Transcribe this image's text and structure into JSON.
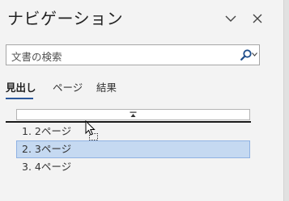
{
  "pane": {
    "title": "ナビゲーション"
  },
  "search": {
    "placeholder": "文書の検索"
  },
  "tabs": [
    {
      "label": "見出し",
      "active": true
    },
    {
      "label": "ページ",
      "active": false
    },
    {
      "label": "結果",
      "active": false
    }
  ],
  "headings": [
    {
      "label": "1. 2ページ",
      "selected": false
    },
    {
      "label": "2. 3ページ",
      "selected": true
    },
    {
      "label": "3. 4ページ",
      "selected": false
    }
  ],
  "colors": {
    "accent": "#2b579a",
    "selection": "#c5d9f1"
  },
  "icons": [
    "chevron-down-icon",
    "close-icon",
    "search-icon",
    "collapse-all-icon",
    "drag-cursor-icon"
  ]
}
